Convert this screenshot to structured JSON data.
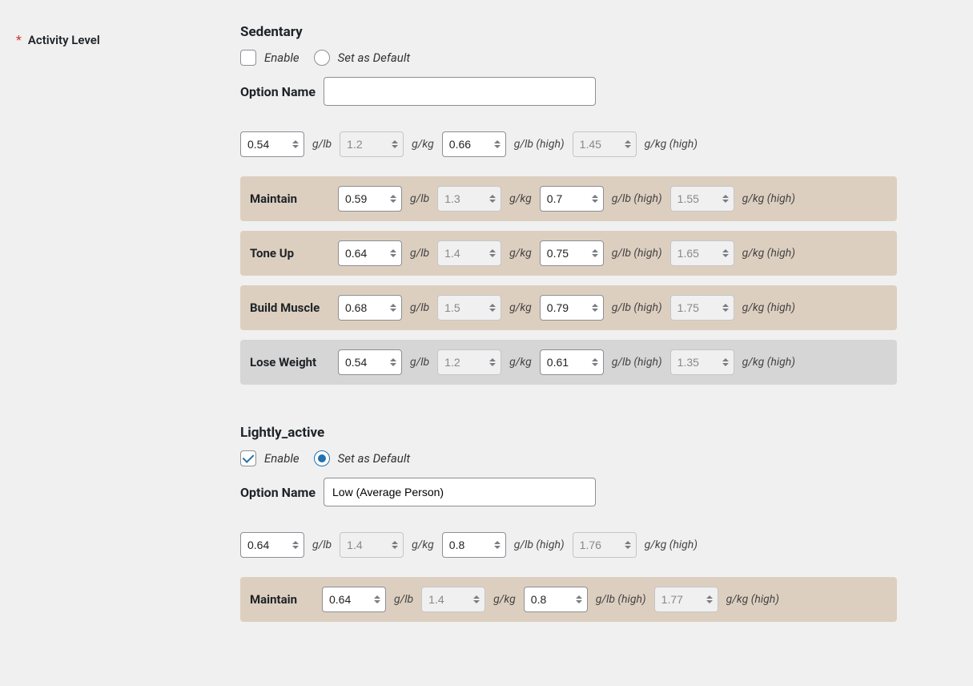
{
  "labels": {
    "field": "Activity Level",
    "enable": "Enable",
    "default": "Set as Default",
    "option_name": "Option Name",
    "glb": "g/lb",
    "gkg": "g/kg",
    "glb_high": "g/lb (high)",
    "gkg_high": "g/kg (high)"
  },
  "levels": [
    {
      "title": "Sedentary",
      "enabled": false,
      "default": false,
      "option_name": "",
      "base": {
        "glb": "0.54",
        "gkg": "1.2",
        "glb_h": "0.66",
        "gkg_h": "1.45"
      },
      "goals": [
        {
          "name": "Maintain",
          "glb": "0.59",
          "gkg": "1.3",
          "glb_h": "0.7",
          "gkg_h": "1.55",
          "style": "tan"
        },
        {
          "name": "Tone Up",
          "glb": "0.64",
          "gkg": "1.4",
          "glb_h": "0.75",
          "gkg_h": "1.65",
          "style": "tan"
        },
        {
          "name": "Build Muscle",
          "glb": "0.68",
          "gkg": "1.5",
          "glb_h": "0.79",
          "gkg_h": "1.75",
          "style": "tan"
        },
        {
          "name": "Lose Weight",
          "glb": "0.54",
          "gkg": "1.2",
          "glb_h": "0.61",
          "gkg_h": "1.35",
          "style": "gray"
        }
      ]
    },
    {
      "title": "Lightly_active",
      "enabled": true,
      "default": true,
      "option_name": "Low (Average Person)",
      "base": {
        "glb": "0.64",
        "gkg": "1.4",
        "glb_h": "0.8",
        "gkg_h": "1.76"
      },
      "goals": [
        {
          "name": "Maintain",
          "glb": "0.64",
          "gkg": "1.4",
          "glb_h": "0.8",
          "gkg_h": "1.77",
          "style": "tan"
        }
      ]
    }
  ]
}
